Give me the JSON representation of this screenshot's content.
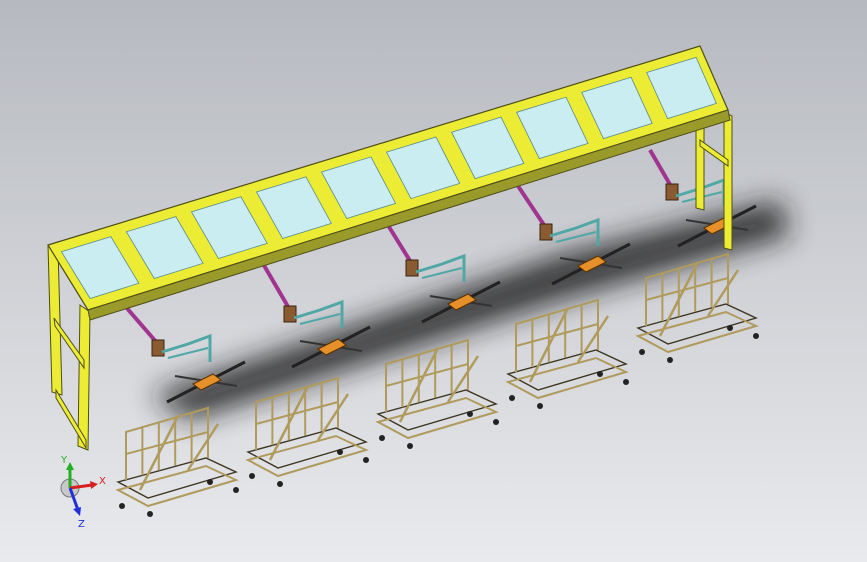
{
  "scene": {
    "colors": {
      "bg_top": "#b6b9bf",
      "bg_bottom": "#e9eaed",
      "frame_yellow": "#ecec34",
      "frame_dark": "#4e4e18",
      "glass": "#c9edf0",
      "glass_edge": "#5a8a8c",
      "arm_purple": "#a0358f",
      "arm_cyan": "#4fa8a6",
      "cart_tan": "#b09a5c",
      "cart_dark": "#3c3520",
      "pad_orange": "#e6902a",
      "shadow": "#1c1c1c"
    },
    "stations": 5
  },
  "triad": {
    "x_label": "X",
    "y_label": "Y",
    "z_label": "Z",
    "x_color": "#d62020",
    "y_color": "#22b020",
    "z_color": "#2030d8"
  }
}
